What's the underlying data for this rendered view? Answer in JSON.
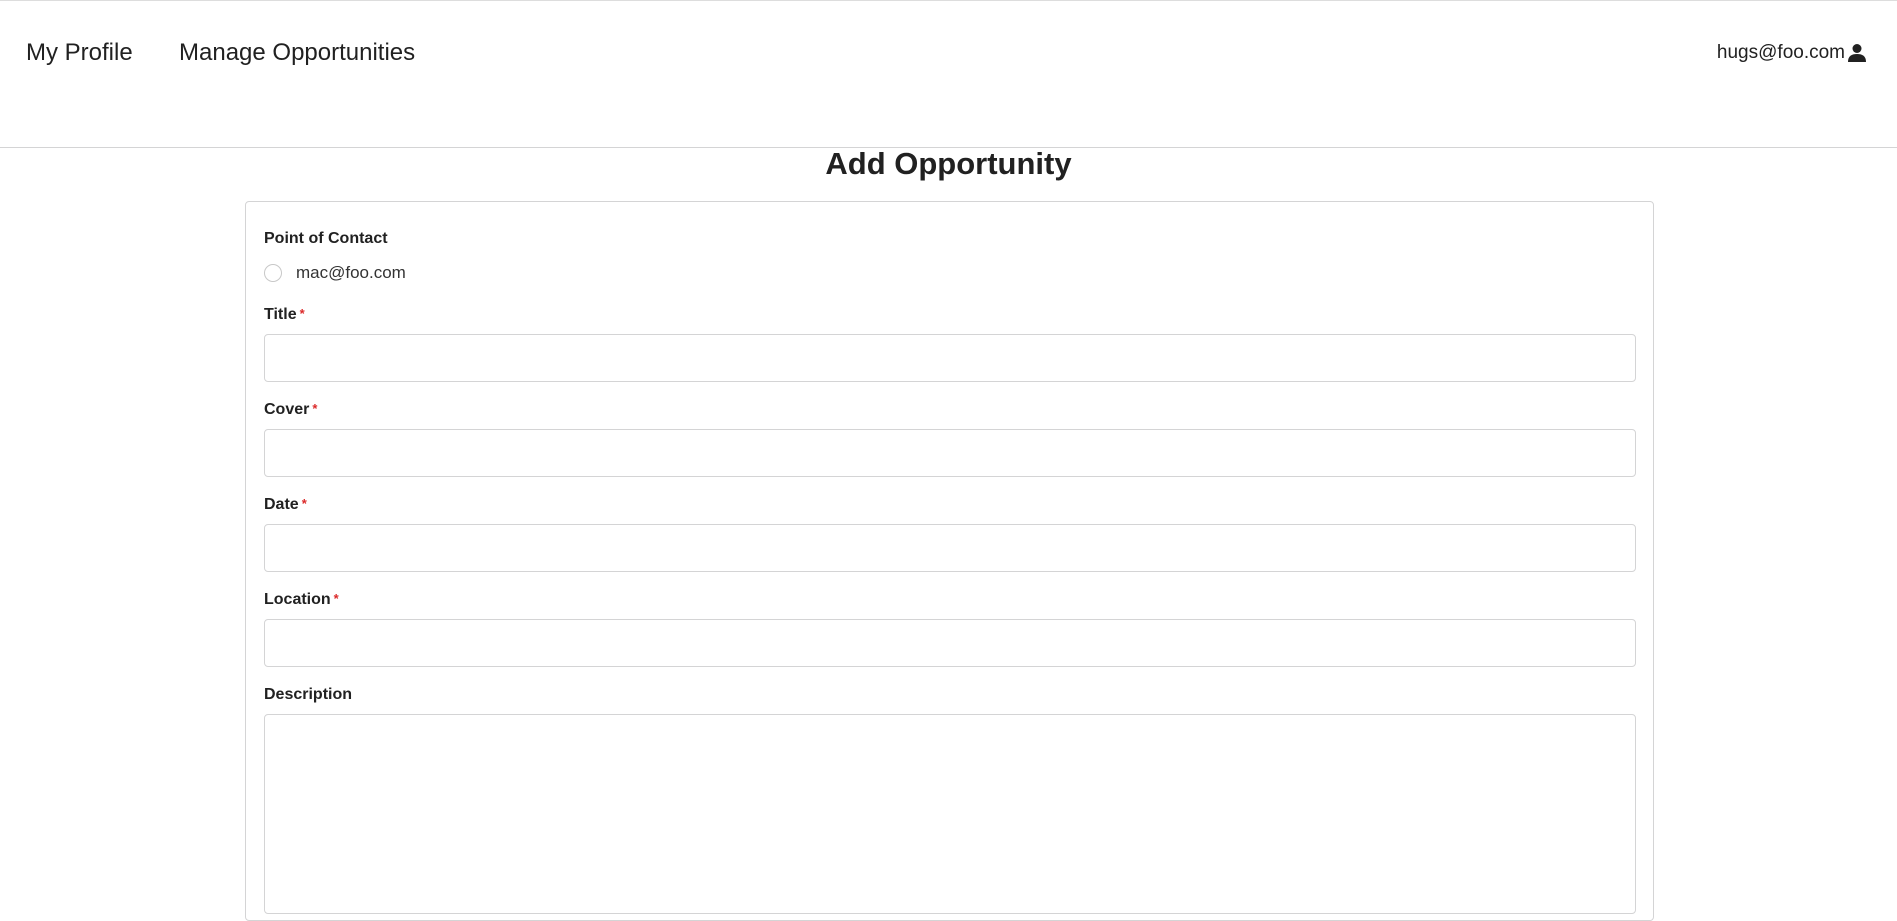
{
  "nav": {
    "my_profile": "My Profile",
    "manage_opportunities": "Manage Opportunities",
    "user_email": "hugs@foo.com",
    "user_icon": "user-icon"
  },
  "page": {
    "title": "Add Opportunity"
  },
  "form": {
    "point_of_contact": {
      "label": "Point of Contact",
      "options": [
        "mac@foo.com"
      ]
    },
    "title": {
      "label": "Title",
      "required_mark": "*",
      "value": ""
    },
    "cover": {
      "label": "Cover",
      "required_mark": "*",
      "value": ""
    },
    "date": {
      "label": "Date",
      "required_mark": "*",
      "value": ""
    },
    "location": {
      "label": "Location",
      "required_mark": "*",
      "value": ""
    },
    "description": {
      "label": "Description",
      "value": ""
    }
  },
  "colors": {
    "text": "#212121",
    "required": "#db2828",
    "border": "#d4d4d5"
  }
}
